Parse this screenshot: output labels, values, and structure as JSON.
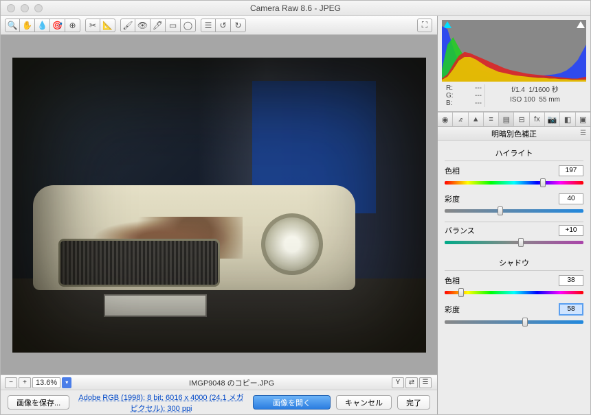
{
  "title": "Camera Raw 8.6  -  JPEG",
  "exif": {
    "r": "---",
    "g": "---",
    "b": "---",
    "aperture": "f/1.4",
    "shutter": "1/1600 秒",
    "iso": "ISO 100",
    "focal": "55 mm"
  },
  "panel_title": "明暗別色補正",
  "sections": {
    "highlights": {
      "label": "ハイライト",
      "hue": {
        "label": "色相",
        "value": "197",
        "pos": 71
      },
      "sat": {
        "label": "彩度",
        "value": "40",
        "pos": 40
      }
    },
    "balance": {
      "label": "バランス",
      "value": "+10",
      "pos": 55
    },
    "shadows": {
      "label": "シャドウ",
      "hue": {
        "label": "色相",
        "value": "38",
        "pos": 12
      },
      "sat": {
        "label": "彩度",
        "value": "58",
        "pos": 58
      }
    }
  },
  "zoom": "13.6%",
  "filename": "IMGP9048 のコピー.JPG",
  "meta_link": "Adobe RGB (1998); 8 bit; 6016 x 4000 (24.1 メガピクセル); 300 ppi",
  "buttons": {
    "save": "画像を保存...",
    "open": "画像を開く",
    "cancel": "キャンセル",
    "done": "完了"
  },
  "labels": {
    "r": "R:",
    "g": "G:",
    "b": "B:"
  },
  "chart_data": {
    "type": "area",
    "title": "RGB Histogram",
    "xlabel": "",
    "ylabel": "",
    "x": [
      0,
      10,
      20,
      30,
      40,
      50,
      60,
      70,
      80,
      90,
      100,
      110,
      120,
      130,
      140,
      150,
      160,
      170,
      180,
      190,
      200,
      210,
      220,
      230,
      240,
      255
    ],
    "series": [
      {
        "name": "blue",
        "color": "#2040ff",
        "values": [
          90,
          85,
          55,
          30,
          18,
          12,
          10,
          9,
          8,
          8,
          8,
          8,
          8,
          8,
          8,
          9,
          9,
          10,
          10,
          11,
          12,
          14,
          18,
          25,
          35,
          60
        ]
      },
      {
        "name": "green",
        "color": "#20d020",
        "values": [
          20,
          60,
          72,
          55,
          40,
          30,
          22,
          18,
          15,
          13,
          12,
          11,
          10,
          10,
          9,
          9,
          8,
          8,
          7,
          7,
          6,
          6,
          5,
          5,
          5,
          5
        ]
      },
      {
        "name": "red",
        "color": "#e02020",
        "values": [
          5,
          12,
          28,
          42,
          48,
          46,
          42,
          38,
          34,
          30,
          26,
          22,
          19,
          17,
          15,
          13,
          12,
          11,
          10,
          9,
          8,
          7,
          6,
          5,
          5,
          8
        ]
      },
      {
        "name": "yellow",
        "color": "#e8d000",
        "values": [
          3,
          8,
          20,
          34,
          40,
          40,
          36,
          30,
          24,
          20,
          16,
          14,
          12,
          10,
          9,
          8,
          7,
          6,
          6,
          5,
          5,
          4,
          4,
          3,
          3,
          3
        ]
      }
    ],
    "xlim": [
      0,
      255
    ],
    "ylim": [
      0,
      100
    ]
  }
}
